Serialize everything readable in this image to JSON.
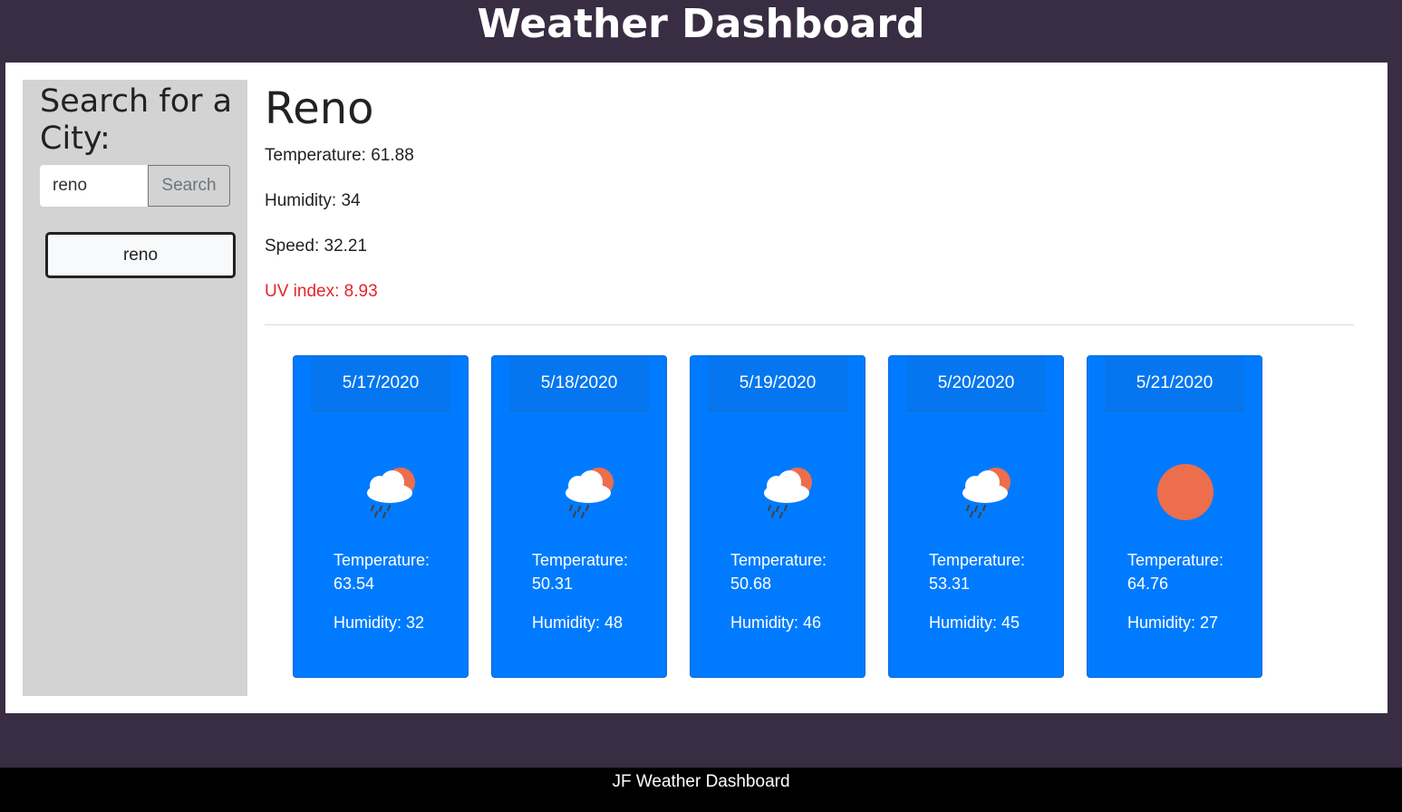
{
  "header": {
    "title": "Weather Dashboard"
  },
  "sidebar": {
    "heading": "Search for a City:",
    "search_value": "reno",
    "search_button": "Search",
    "history": [
      "reno"
    ]
  },
  "current": {
    "city": "Reno",
    "temperature": "Temperature: 61.88",
    "humidity": "Humidity: 34",
    "speed": "Speed: 32.21",
    "uv": "UV index: 8.93",
    "uv_color": "#e8232a"
  },
  "forecast": [
    {
      "date": "5/17/2020",
      "icon": "rain-cloud-sun-icon",
      "temp_label": "Temperature:",
      "temp": "63.54",
      "humidity": "Humidity: 32"
    },
    {
      "date": "5/18/2020",
      "icon": "rain-cloud-sun-icon",
      "temp_label": "Temperature:",
      "temp": "50.31",
      "humidity": "Humidity: 48"
    },
    {
      "date": "5/19/2020",
      "icon": "rain-cloud-sun-icon",
      "temp_label": "Temperature:",
      "temp": "50.68",
      "humidity": "Humidity: 46"
    },
    {
      "date": "5/20/2020",
      "icon": "rain-cloud-sun-icon",
      "temp_label": "Temperature:",
      "temp": "53.31",
      "humidity": "Humidity: 45"
    },
    {
      "date": "5/21/2020",
      "icon": "sun-icon",
      "temp_label": "Temperature:",
      "temp": "64.76",
      "humidity": "Humidity: 27"
    }
  ],
  "colors": {
    "background": "#382d42",
    "card": "#007bff",
    "sun": "#ec6e4c",
    "footer": "#000000"
  },
  "footer": {
    "text": "JF Weather Dashboard"
  }
}
